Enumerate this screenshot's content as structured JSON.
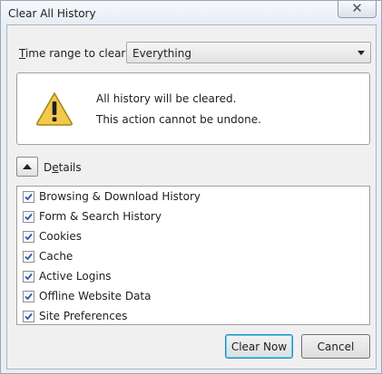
{
  "window": {
    "title": "Clear All History",
    "close_glyph": "✕"
  },
  "time_range": {
    "label_accesskey": "T",
    "label_rest": "ime range to clear:",
    "value": "Everything"
  },
  "warning": {
    "icon": "warning-triangle-icon",
    "line1": "All history will be cleared.",
    "line2": "This action cannot be undone."
  },
  "details": {
    "label_prefix": "D",
    "label_accesskey": "e",
    "label_rest": "tails",
    "expanded": true,
    "items": [
      {
        "label": "Browsing & Download History",
        "checked": true
      },
      {
        "label": "Form & Search History",
        "checked": true
      },
      {
        "label": "Cookies",
        "checked": true
      },
      {
        "label": "Cache",
        "checked": true
      },
      {
        "label": "Active Logins",
        "checked": true
      },
      {
        "label": "Offline Website Data",
        "checked": true
      },
      {
        "label": "Site Preferences",
        "checked": true
      }
    ]
  },
  "buttons": {
    "clear_now": "Clear Now",
    "cancel": "Cancel"
  },
  "colors": {
    "accent": "#3c7fb1",
    "warning": "#f2c94c"
  }
}
